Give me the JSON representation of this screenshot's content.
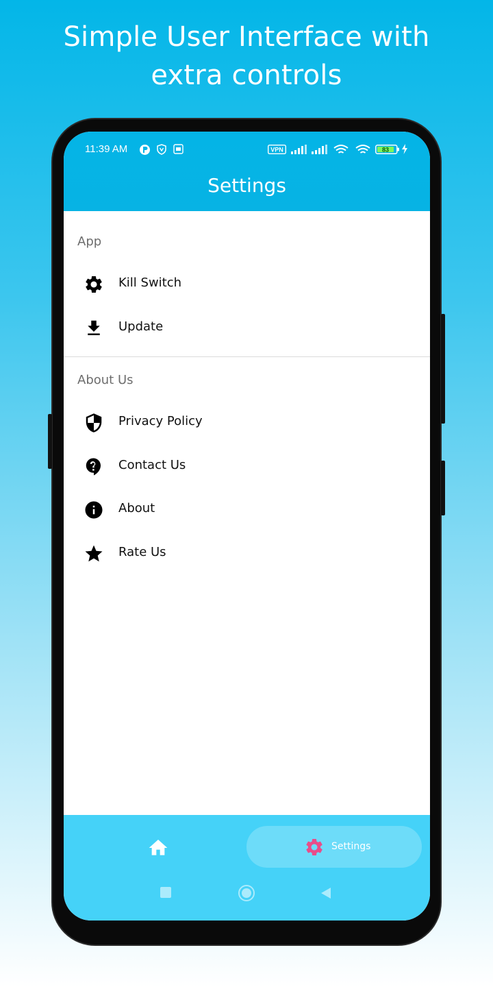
{
  "promo": {
    "line1": "Simple User Interface with",
    "line2": "extra controls"
  },
  "status_bar": {
    "time": "11:39 AM",
    "vpn": "VPN",
    "battery": "83"
  },
  "app_bar": {
    "title": "Settings"
  },
  "sections": [
    {
      "header": "App",
      "items": [
        {
          "label": "Kill Switch",
          "icon": "gear-icon"
        },
        {
          "label": "Update",
          "icon": "download-icon"
        }
      ]
    },
    {
      "header": "About Us",
      "items": [
        {
          "label": "Privacy Policy",
          "icon": "shield-icon"
        },
        {
          "label": "Contact Us",
          "icon": "help-icon"
        },
        {
          "label": "About",
          "icon": "info-icon"
        },
        {
          "label": "Rate Us",
          "icon": "star-icon"
        }
      ]
    }
  ],
  "bottom_nav": {
    "settings_label": "Settings",
    "active_tab": "settings",
    "active_color": "#e94d8a"
  },
  "colors": {
    "primary": "#04b4e6",
    "nav_bar": "#45d2f8"
  }
}
